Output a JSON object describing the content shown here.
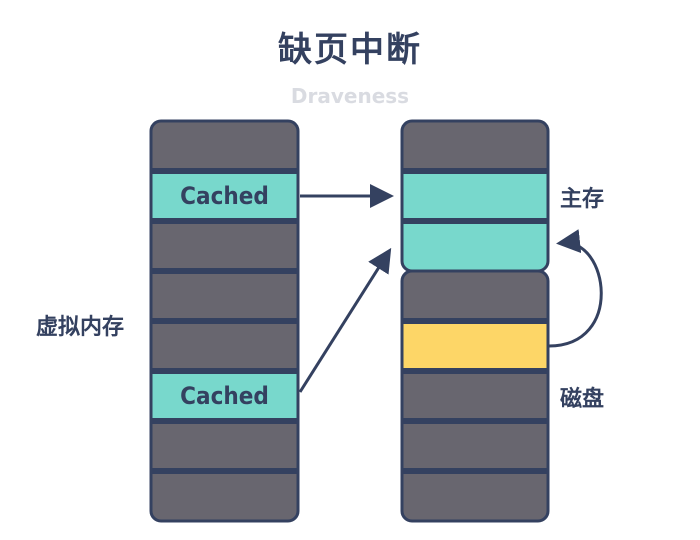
{
  "title": "缺页中断",
  "subtitle": "Draveness",
  "labels": {
    "virtual_memory": "虚拟内存",
    "main_memory": "主存",
    "disk": "磁盘"
  },
  "colors": {
    "border": "#344160",
    "empty": "#68666f",
    "cached": "#78d8cc",
    "disk_page": "#fdd667",
    "subtitle": "#d9dbe1"
  },
  "virtual_memory": {
    "cells": [
      {
        "state": "empty",
        "text": ""
      },
      {
        "state": "cached",
        "text": "Cached"
      },
      {
        "state": "empty",
        "text": ""
      },
      {
        "state": "empty",
        "text": ""
      },
      {
        "state": "empty",
        "text": ""
      },
      {
        "state": "cached",
        "text": "Cached"
      },
      {
        "state": "empty",
        "text": ""
      },
      {
        "state": "empty",
        "text": ""
      }
    ]
  },
  "main_memory": {
    "cells": [
      {
        "state": "empty"
      },
      {
        "state": "cached"
      },
      {
        "state": "cached"
      }
    ]
  },
  "disk": {
    "cells": [
      {
        "state": "empty"
      },
      {
        "state": "disk_page"
      },
      {
        "state": "empty"
      },
      {
        "state": "empty"
      },
      {
        "state": "empty"
      }
    ]
  },
  "arrows": [
    {
      "from": "virtual_memory.1",
      "to": "main_memory.1"
    },
    {
      "from": "virtual_memory.5",
      "to": "main_memory.2"
    },
    {
      "from": "disk.1",
      "to": "main_memory.2"
    }
  ]
}
